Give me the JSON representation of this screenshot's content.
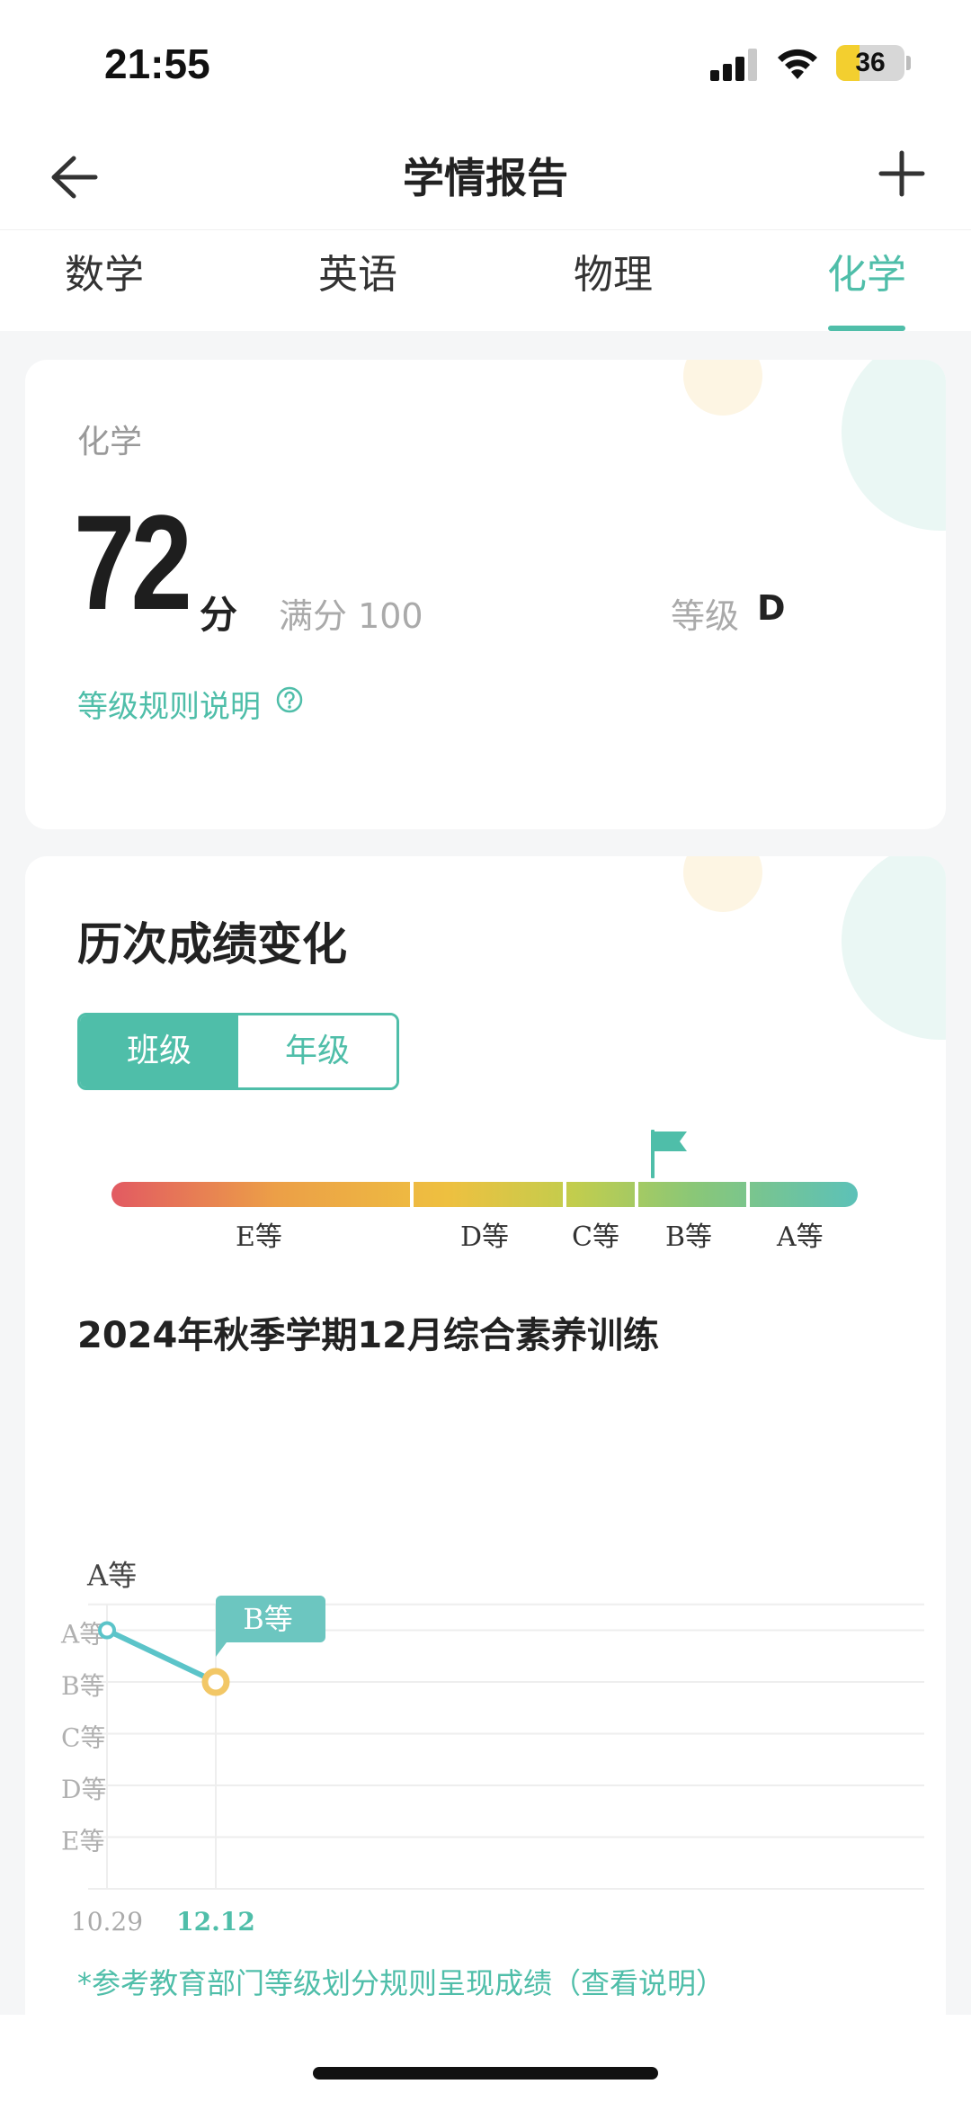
{
  "status_bar": {
    "time": "21:55",
    "battery": "36"
  },
  "nav": {
    "title": "学情报告"
  },
  "tabs": [
    {
      "label": "数学"
    },
    {
      "label": "英语"
    },
    {
      "label": "物理"
    },
    {
      "label": "化学"
    }
  ],
  "active_tab": "化学",
  "score_card": {
    "subject": "化学",
    "score": "72",
    "unit": "分",
    "full_score": "满分 100",
    "grade_label": "等级",
    "grade_value": "D",
    "rule_link": "等级规则说明"
  },
  "history": {
    "title": "历次成绩变化",
    "toggle": {
      "class_label": "班级",
      "grade_label": "年级",
      "selected": "班级"
    },
    "grade_bar": {
      "segments": [
        "E等",
        "D等",
        "C等",
        "B等",
        "A等"
      ],
      "flag_at": "B等"
    },
    "term_title": "2024年秋季学期12月综合素养训练",
    "note": "*参考教育部门等级划分规则呈现成绩（查看说明）"
  },
  "colors": {
    "accent": "#4fbea9",
    "point_first": "#5bc4c9",
    "point_last": "#f2c766"
  },
  "chart_data": {
    "type": "line",
    "x": [
      "10.29",
      "12.12"
    ],
    "y_categories": [
      "E等",
      "D等",
      "C等",
      "B等",
      "A等"
    ],
    "series": [
      {
        "values": [
          "A等",
          "B等"
        ],
        "point_labels": [
          "A等",
          "B等"
        ]
      }
    ],
    "highlight_x": "12.12",
    "grid": true
  }
}
